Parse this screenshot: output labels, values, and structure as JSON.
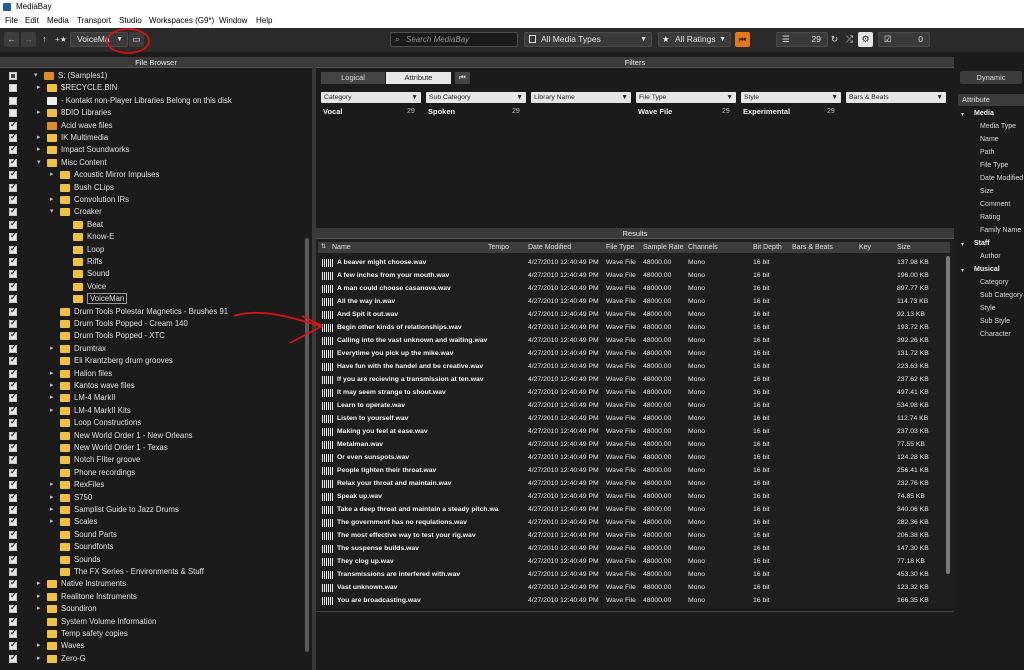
{
  "app": {
    "title": "MediaBay"
  },
  "menu": [
    "File",
    "Edit",
    "Media",
    "Transport",
    "Studio",
    "Workspaces (G9*)",
    "Window",
    "Help"
  ],
  "toolbar": {
    "preset": "VoiceMa",
    "search_placeholder": "Search MediaBay",
    "media_types": "All Media Types",
    "ratings": "All Ratings",
    "result_count": "29",
    "selected_count": "0"
  },
  "file_browser": {
    "title": "File Browser",
    "items": [
      {
        "label": "S: (Samples1)",
        "level": 0,
        "check": "part",
        "twisty": "open",
        "icon": "drive"
      },
      {
        "label": "$RECYCLE.BIN",
        "level": 1,
        "check": "none",
        "twisty": "closed",
        "icon": "folder"
      },
      {
        "label": "- Kontakt non-Player Libraries Belong on this disk",
        "level": 1,
        "check": "none",
        "twisty": "none",
        "icon": "folder-white"
      },
      {
        "label": "8DIO Libraries",
        "level": 1,
        "check": "none",
        "twisty": "closed",
        "icon": "folder"
      },
      {
        "label": "Acid wave files",
        "level": 1,
        "check": "chk",
        "twisty": "none",
        "icon": "folder-orange"
      },
      {
        "label": "IK Multimedia",
        "level": 1,
        "check": "chk",
        "twisty": "closed",
        "icon": "folder"
      },
      {
        "label": "Impact Soundworks",
        "level": 1,
        "check": "chk",
        "twisty": "closed",
        "icon": "folder"
      },
      {
        "label": "Misc Content",
        "level": 1,
        "check": "chk",
        "twisty": "open",
        "icon": "folder"
      },
      {
        "label": "Acoustic Mirror Impulses",
        "level": 2,
        "check": "chk",
        "twisty": "closed",
        "icon": "folder"
      },
      {
        "label": "Bush CLips",
        "level": 2,
        "check": "chk",
        "twisty": "none",
        "icon": "folder"
      },
      {
        "label": "Convolution IRs",
        "level": 2,
        "check": "chk",
        "twisty": "closed",
        "icon": "folder"
      },
      {
        "label": "Croaker",
        "level": 2,
        "check": "chk",
        "twisty": "open",
        "icon": "folder"
      },
      {
        "label": "Beat",
        "level": 3,
        "check": "chk",
        "twisty": "none",
        "icon": "folder"
      },
      {
        "label": "Know-E",
        "level": 3,
        "check": "chk",
        "twisty": "none",
        "icon": "folder"
      },
      {
        "label": "Loop",
        "level": 3,
        "check": "chk",
        "twisty": "none",
        "icon": "folder"
      },
      {
        "label": "Riffs",
        "level": 3,
        "check": "chk",
        "twisty": "none",
        "icon": "folder"
      },
      {
        "label": "Sound",
        "level": 3,
        "check": "chk",
        "twisty": "none",
        "icon": "folder"
      },
      {
        "label": "Voice",
        "level": 3,
        "check": "chk",
        "twisty": "none",
        "icon": "folder"
      },
      {
        "label": "VoiceMan",
        "level": 3,
        "check": "chk",
        "twisty": "none",
        "icon": "folder",
        "selected": true
      },
      {
        "label": "Drum Tools Polestar Magnetics - Brushes 91",
        "level": 2,
        "check": "chk",
        "twisty": "none",
        "icon": "folder"
      },
      {
        "label": "Drum Tools Popped - Cream 140",
        "level": 2,
        "check": "chk",
        "twisty": "none",
        "icon": "folder"
      },
      {
        "label": "Drum Tools Popped - XTC",
        "level": 2,
        "check": "chk",
        "twisty": "none",
        "icon": "folder"
      },
      {
        "label": "Drumtrax",
        "level": 2,
        "check": "chk",
        "twisty": "closed",
        "icon": "folder"
      },
      {
        "label": "Eli Krantzberg drum grooves",
        "level": 2,
        "check": "chk",
        "twisty": "none",
        "icon": "folder"
      },
      {
        "label": "Halion files",
        "level": 2,
        "check": "chk",
        "twisty": "closed",
        "icon": "folder"
      },
      {
        "label": "Kantos wave files",
        "level": 2,
        "check": "chk",
        "twisty": "closed",
        "icon": "folder"
      },
      {
        "label": "LM-4 MarkII",
        "level": 2,
        "check": "chk",
        "twisty": "closed",
        "icon": "folder"
      },
      {
        "label": "LM-4 MarkII Kits",
        "level": 2,
        "check": "chk",
        "twisty": "closed",
        "icon": "folder"
      },
      {
        "label": "Loop Constructions",
        "level": 2,
        "check": "chk",
        "twisty": "none",
        "icon": "folder"
      },
      {
        "label": "New World Order 1 - New Orleans",
        "level": 2,
        "check": "chk",
        "twisty": "none",
        "icon": "folder"
      },
      {
        "label": "New World Order 1 - Texas",
        "level": 2,
        "check": "chk",
        "twisty": "none",
        "icon": "folder"
      },
      {
        "label": "Notch FIlter groove",
        "level": 2,
        "check": "chk",
        "twisty": "none",
        "icon": "folder"
      },
      {
        "label": "Phone recordings",
        "level": 2,
        "check": "chk",
        "twisty": "none",
        "icon": "folder"
      },
      {
        "label": "RexFiles",
        "level": 2,
        "check": "chk",
        "twisty": "closed",
        "icon": "folder"
      },
      {
        "label": "S750",
        "level": 2,
        "check": "chk",
        "twisty": "closed",
        "icon": "folder"
      },
      {
        "label": "Samplist Guide to Jazz Drums",
        "level": 2,
        "check": "chk",
        "twisty": "closed",
        "icon": "folder"
      },
      {
        "label": "Scales",
        "level": 2,
        "check": "chk",
        "twisty": "closed",
        "icon": "folder"
      },
      {
        "label": "Sound Parts",
        "level": 2,
        "check": "chk",
        "twisty": "none",
        "icon": "folder"
      },
      {
        "label": "Soundfonts",
        "level": 2,
        "check": "chk",
        "twisty": "none",
        "icon": "folder"
      },
      {
        "label": "Sounds",
        "level": 2,
        "check": "chk",
        "twisty": "none",
        "icon": "folder"
      },
      {
        "label": "The FX Series - Environments & Stuff",
        "level": 2,
        "check": "chk",
        "twisty": "none",
        "icon": "folder"
      },
      {
        "label": "Native Instruments",
        "level": 1,
        "check": "chk",
        "twisty": "closed",
        "icon": "folder"
      },
      {
        "label": "Realitone Instruments",
        "level": 1,
        "check": "chk",
        "twisty": "closed",
        "icon": "folder"
      },
      {
        "label": "Soundiron",
        "level": 1,
        "check": "chk",
        "twisty": "closed",
        "icon": "folder"
      },
      {
        "label": "System Volume Information",
        "level": 1,
        "check": "chk",
        "twisty": "none",
        "icon": "folder"
      },
      {
        "label": "Temp safety copies",
        "level": 1,
        "check": "chk",
        "twisty": "none",
        "icon": "folder"
      },
      {
        "label": "Waves",
        "level": 1,
        "check": "chk",
        "twisty": "closed",
        "icon": "folder"
      },
      {
        "label": "Zero-G",
        "level": 1,
        "check": "chk",
        "twisty": "closed",
        "icon": "folder"
      }
    ]
  },
  "filters": {
    "title": "Filters",
    "tabs": [
      "Logical",
      "Attribute"
    ],
    "active_tab": "Attribute",
    "columns": [
      {
        "header": "Category",
        "value": "Vocal",
        "count": "29"
      },
      {
        "header": "Sub Category",
        "value": "Spoken",
        "count": "29"
      },
      {
        "header": "Library Name",
        "value": "",
        "count": ""
      },
      {
        "header": "File Type",
        "value": "Wave File",
        "count": "29"
      },
      {
        "header": "Style",
        "value": "Experimental",
        "count": "29"
      },
      {
        "header": "Bars & Beats",
        "value": "",
        "count": ""
      }
    ]
  },
  "results": {
    "title": "Results",
    "columns": [
      "Name",
      "Tempo",
      "Date Modified",
      "File Type",
      "Sample Rate",
      "Channels",
      "Bit Depth",
      "Bars & Beats",
      "Key",
      "Size"
    ],
    "rows": [
      {
        "name": "A beaver might choose.wav",
        "size": "137.98 KB"
      },
      {
        "name": "A few inches from your mouth.wav",
        "size": "196.00 KB"
      },
      {
        "name": "A man could choose casanova.wav",
        "size": "897.77 KB"
      },
      {
        "name": "All the way in.wav",
        "size": "114.73 KB"
      },
      {
        "name": "And Spit it out.wav",
        "size": "92.13 KB"
      },
      {
        "name": "Begin other kinds of relationships.wav",
        "size": "193.72 KB"
      },
      {
        "name": "Calling into the vast unknown and waiting.wav",
        "size": "392.26 KB"
      },
      {
        "name": "Everytime you pick up the mike.wav",
        "size": "131.72 KB"
      },
      {
        "name": "Have fun with the handel and be creative.wav",
        "size": "223.63 KB"
      },
      {
        "name": "If you are recieving a transmission at ten.wav",
        "size": "237.62 KB"
      },
      {
        "name": "It may seem strange to shout.wav",
        "size": "497.41 KB"
      },
      {
        "name": "Learn to operate.wav",
        "size": "534.98 KB"
      },
      {
        "name": "Listen to yourself.wav",
        "size": "112.74 KB"
      },
      {
        "name": "Making you feel at ease.wav",
        "size": "237.03 KB"
      },
      {
        "name": "Metalman.wav",
        "size": "77.55 KB"
      },
      {
        "name": "Or even sunspots.wav",
        "size": "124.28 KB"
      },
      {
        "name": "People tighten their throat.wav",
        "size": "256.41 KB"
      },
      {
        "name": "Relax your throat and maintain.wav",
        "size": "232.76 KB"
      },
      {
        "name": "Speak up.wav",
        "size": "74.85 KB"
      },
      {
        "name": "Take a deep throat and maintain a steady pitch.wa",
        "size": "340.06 KB"
      },
      {
        "name": "The government has no requlations.wav",
        "size": "282.36 KB"
      },
      {
        "name": "The most effective way to test your rig.wav",
        "size": "206.38 KB"
      },
      {
        "name": "The suspense builds.wav",
        "size": "147.30 KB"
      },
      {
        "name": "They clog up.wav",
        "size": "77.18 KB"
      },
      {
        "name": "Transmissions are interfered with.wav",
        "size": "453.30 KB"
      },
      {
        "name": "Vast unknown.wav",
        "size": "123.32 KB"
      },
      {
        "name": "You are broadcasting.wav",
        "size": "166.35 KB"
      }
    ],
    "date": "4/27/2010 12:40:49 PM",
    "file_type": "Wave File",
    "sample_rate": "48000.00",
    "channels": "Mono",
    "bit_depth": "16 bit"
  },
  "attribute_panel": {
    "tab": "Dynamic",
    "header": "Attribute",
    "groups": [
      {
        "label": "Media",
        "items": [
          "Media Type",
          "Name",
          "Path",
          "File Type",
          "Date Modified",
          "Size",
          "Comment",
          "Rating",
          "Family Name"
        ]
      },
      {
        "label": "Staff",
        "items": [
          "Author"
        ]
      },
      {
        "label": "Musical",
        "items": [
          "Category",
          "Sub Category",
          "Style",
          "Sub Style",
          "Character"
        ]
      }
    ]
  },
  "colors": {
    "accent": "#e67817",
    "annotation": "#e01010"
  }
}
